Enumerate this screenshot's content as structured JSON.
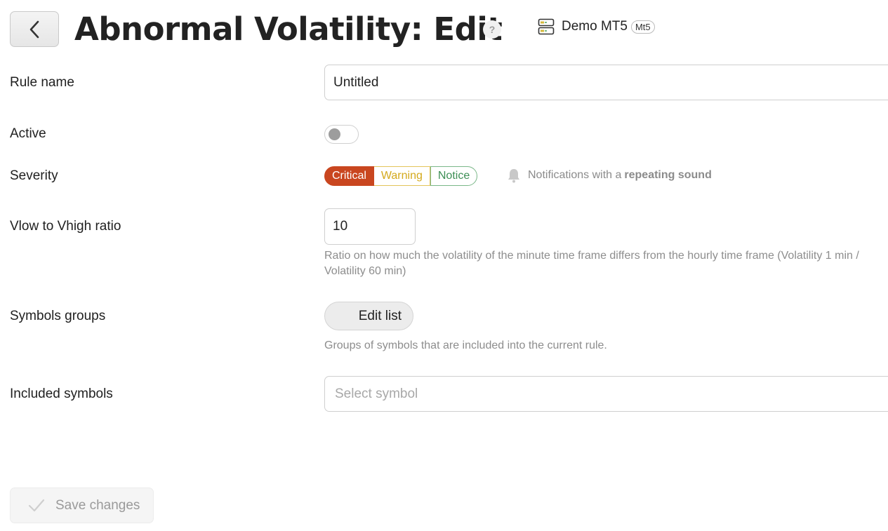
{
  "header": {
    "title": "Abnormal Volatility: Edit",
    "help_icon": "?",
    "server_name": "Demo MT5",
    "server_badge": "Mt5"
  },
  "icons": {
    "back": "chevron-left-icon",
    "help": "question-icon",
    "server": "server-icon",
    "bell": "bell-icon",
    "check": "check-icon"
  },
  "form": {
    "rule_name": {
      "label": "Rule name",
      "value": "Untitled"
    },
    "active": {
      "label": "Active",
      "checked": false
    },
    "severity": {
      "label": "Severity",
      "options": [
        "Critical",
        "Warning",
        "Notice"
      ],
      "selected": "Critical",
      "note_prefix": "Notifications with a",
      "note_bold": "repeating sound"
    },
    "ratio": {
      "label": "Vlow to Vhigh ratio",
      "value": "10",
      "help": "Ratio on how much the volatility of the minute time frame differs from the hourly time frame (Volatility 1 min / Volatility 60 min)"
    },
    "symbols_groups": {
      "label": "Symbols groups",
      "button": "Edit list",
      "help": "Groups of symbols that are included into the current rule."
    },
    "included_symbols": {
      "label": "Included symbols",
      "placeholder": "Select symbol"
    }
  },
  "footer": {
    "save_label": "Save changes"
  },
  "colors": {
    "critical": "#c9461f",
    "warning": "#d4a91c",
    "notice": "#3d8f55"
  }
}
